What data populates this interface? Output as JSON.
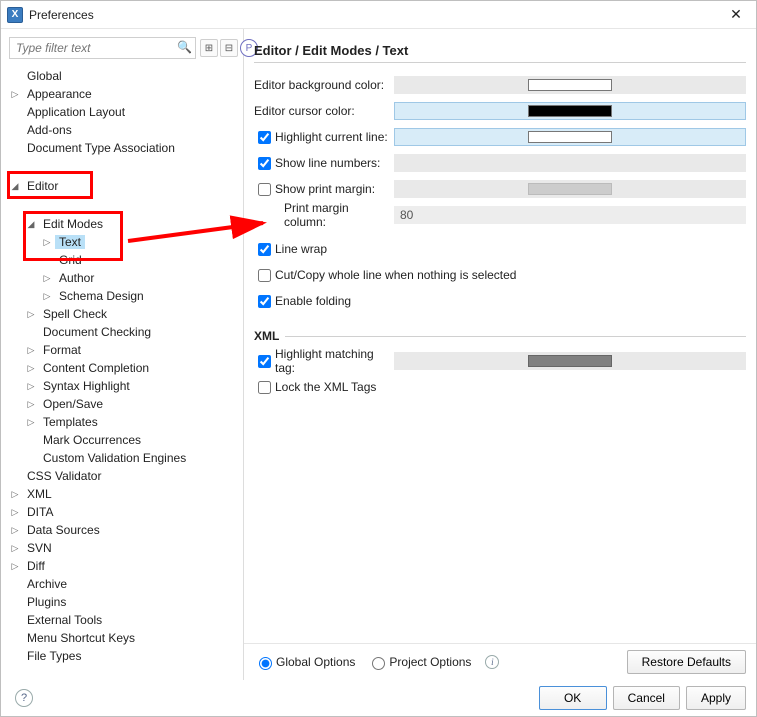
{
  "window": {
    "title": "Preferences"
  },
  "filter": {
    "placeholder": "Type filter text"
  },
  "tree": {
    "global": "Global",
    "appearance": "Appearance",
    "application_layout": "Application Layout",
    "addons": "Add-ons",
    "doc_type_assoc": "Document Type Association",
    "editor": "Editor",
    "edit_modes": "Edit Modes",
    "text": "Text",
    "grid": "Grid",
    "author": "Author",
    "schema_design": "Schema Design",
    "spell_check": "Spell Check",
    "document_checking": "Document Checking",
    "format": "Format",
    "content_completion": "Content Completion",
    "syntax_highlight": "Syntax Highlight",
    "open_save": "Open/Save",
    "templates": "Templates",
    "mark_occurrences": "Mark Occurrences",
    "custom_validation": "Custom Validation Engines",
    "css_validator": "CSS Validator",
    "xml": "XML",
    "dita": "DITA",
    "data_sources": "Data Sources",
    "svn": "SVN",
    "diff": "Diff",
    "archive": "Archive",
    "plugins": "Plugins",
    "external_tools": "External Tools",
    "menu_shortcut": "Menu Shortcut Keys",
    "file_types": "File Types"
  },
  "breadcrumb": "Editor / Edit Modes / Text",
  "form": {
    "bg_color_label": "Editor background color:",
    "bg_color_value": "#ffffff",
    "cursor_color_label": "Editor cursor color:",
    "cursor_color_value": "#000000",
    "highlight_line_label": "Highlight current line:",
    "highlight_line_checked": true,
    "highlight_line_value": "#ffffff",
    "line_numbers_label": "Show line numbers:",
    "line_numbers_checked": true,
    "print_margin_label": "Show print margin:",
    "print_margin_checked": false,
    "print_margin_col_label": "Print margin column:",
    "print_margin_col_value": "80",
    "line_wrap_label": "Line wrap",
    "line_wrap_checked": true,
    "cutcopy_label": "Cut/Copy whole line when nothing is selected",
    "cutcopy_checked": false,
    "folding_label": "Enable folding",
    "folding_checked": true,
    "xml_section": "XML",
    "highlight_tag_label": "Highlight matching tag:",
    "highlight_tag_checked": true,
    "highlight_tag_value": "#808080",
    "lock_xml_label": "Lock the XML Tags",
    "lock_xml_checked": false
  },
  "options_bar": {
    "global_options": "Global Options",
    "project_options": "Project Options",
    "restore_defaults": "Restore Defaults"
  },
  "footer": {
    "ok": "OK",
    "cancel": "Cancel",
    "apply": "Apply"
  }
}
